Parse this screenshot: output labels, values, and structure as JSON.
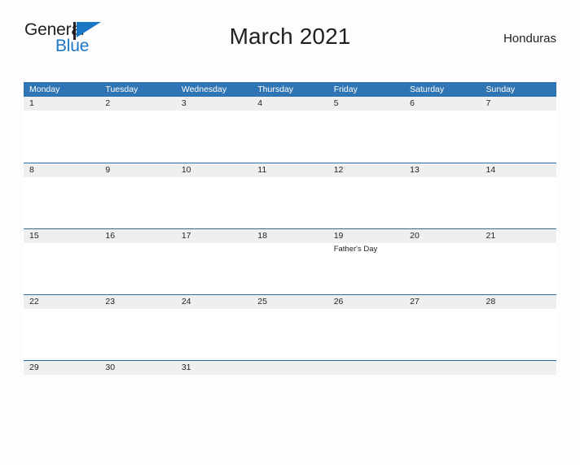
{
  "logo": {
    "word_one": "General",
    "word_two": "Blue",
    "flag_icon": "flag-icon",
    "brand_blue": "#1b76c4",
    "brand_black": "#231f20"
  },
  "header": {
    "title": "March 2021",
    "country": "Honduras"
  },
  "calendar": {
    "header_color": "#3075b3",
    "row_strip_color": "#efeff0",
    "weekdays": [
      "Monday",
      "Tuesday",
      "Wednesday",
      "Thursday",
      "Friday",
      "Saturday",
      "Sunday"
    ],
    "weeks": [
      {
        "days": [
          {
            "number": "1",
            "events": []
          },
          {
            "number": "2",
            "events": []
          },
          {
            "number": "3",
            "events": []
          },
          {
            "number": "4",
            "events": []
          },
          {
            "number": "5",
            "events": []
          },
          {
            "number": "6",
            "events": []
          },
          {
            "number": "7",
            "events": []
          }
        ]
      },
      {
        "days": [
          {
            "number": "8",
            "events": []
          },
          {
            "number": "9",
            "events": []
          },
          {
            "number": "10",
            "events": []
          },
          {
            "number": "11",
            "events": []
          },
          {
            "number": "12",
            "events": []
          },
          {
            "number": "13",
            "events": []
          },
          {
            "number": "14",
            "events": []
          }
        ]
      },
      {
        "days": [
          {
            "number": "15",
            "events": []
          },
          {
            "number": "16",
            "events": []
          },
          {
            "number": "17",
            "events": []
          },
          {
            "number": "18",
            "events": []
          },
          {
            "number": "19",
            "events": [
              "Father's Day"
            ]
          },
          {
            "number": "20",
            "events": []
          },
          {
            "number": "21",
            "events": []
          }
        ]
      },
      {
        "days": [
          {
            "number": "22",
            "events": []
          },
          {
            "number": "23",
            "events": []
          },
          {
            "number": "24",
            "events": []
          },
          {
            "number": "25",
            "events": []
          },
          {
            "number": "26",
            "events": []
          },
          {
            "number": "27",
            "events": []
          },
          {
            "number": "28",
            "events": []
          }
        ]
      },
      {
        "days": [
          {
            "number": "29",
            "events": []
          },
          {
            "number": "30",
            "events": []
          },
          {
            "number": "31",
            "events": []
          },
          {
            "number": "",
            "events": []
          },
          {
            "number": "",
            "events": []
          },
          {
            "number": "",
            "events": []
          },
          {
            "number": "",
            "events": []
          }
        ]
      }
    ]
  }
}
